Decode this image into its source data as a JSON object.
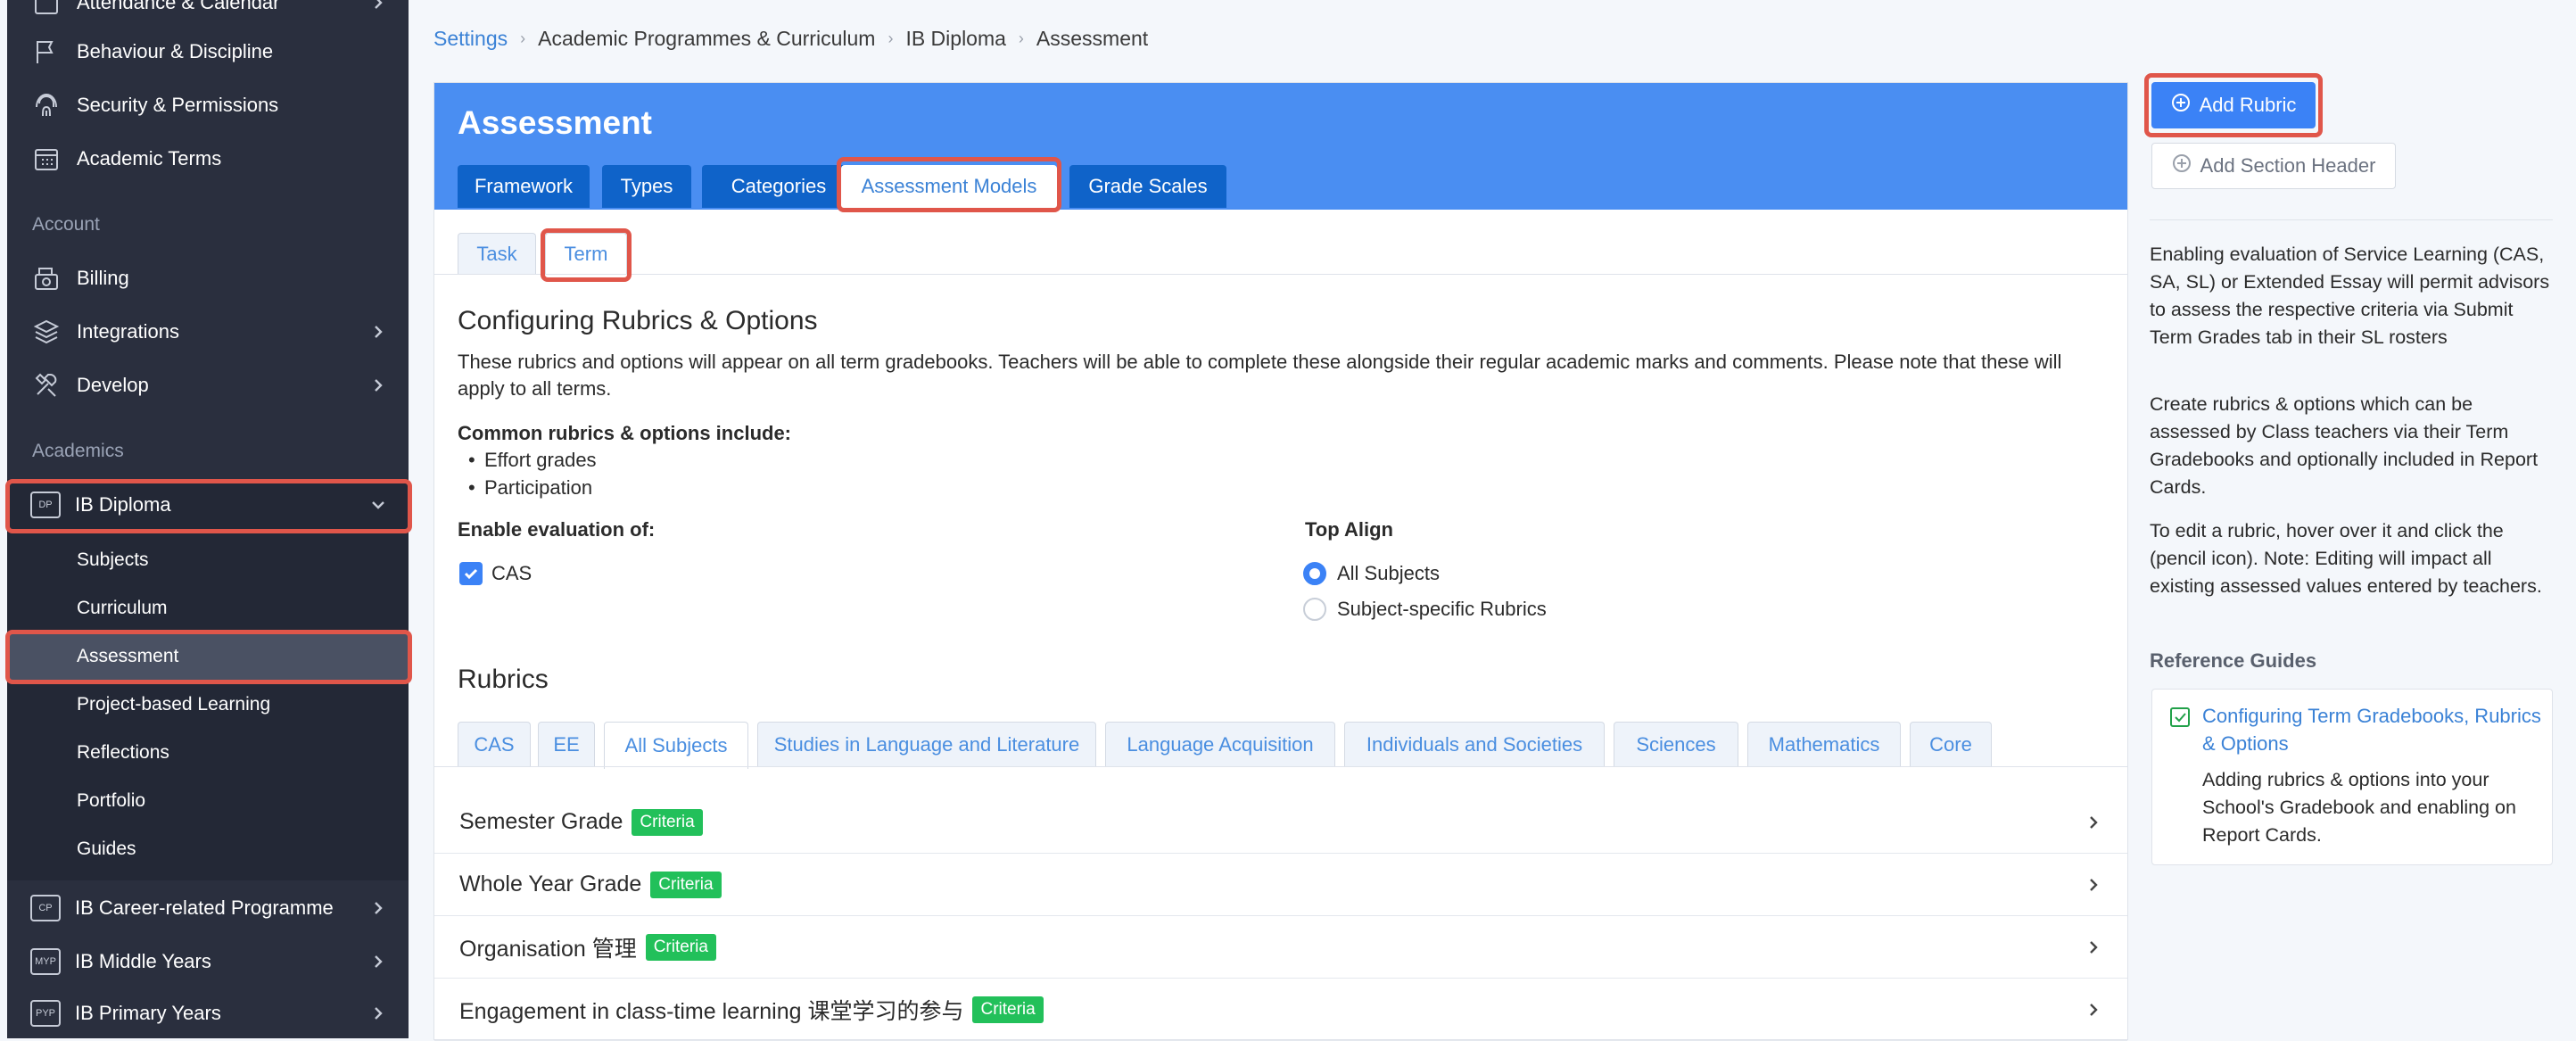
{
  "sidebar": {
    "items_top": [
      {
        "label": "Attendance & Calendar",
        "icon": "calendar-check-icon"
      },
      {
        "label": "Behaviour & Discipline",
        "icon": "flag-icon"
      },
      {
        "label": "Security & Permissions",
        "icon": "fingerprint-icon"
      },
      {
        "label": "Academic Terms",
        "icon": "calendar-grid-icon"
      }
    ],
    "section_account": "Account",
    "account_items": [
      {
        "label": "Billing",
        "icon": "register-icon"
      },
      {
        "label": "Integrations",
        "icon": "layers-icon"
      },
      {
        "label": "Develop",
        "icon": "tools-icon"
      }
    ],
    "section_academics": "Academics",
    "programme": {
      "label": "IB Diploma",
      "badge": "DP"
    },
    "sub_items": [
      "Subjects",
      "Curriculum",
      "Assessment",
      "Project-based Learning",
      "Reflections",
      "Portfolio",
      "Guides"
    ],
    "active_sub": "Assessment",
    "other_programmes": [
      {
        "label": "IB Career-related Programme",
        "badge": "CP"
      },
      {
        "label": "IB Middle Years",
        "badge": "MYP"
      },
      {
        "label": "IB Primary Years",
        "badge": "PYP"
      }
    ]
  },
  "breadcrumb": [
    "Settings",
    "Academic Programmes & Curriculum",
    "IB Diploma",
    "Assessment"
  ],
  "main": {
    "title": "Assessment",
    "tabs": [
      "Framework",
      "Types",
      "Categories",
      "Assessment Models",
      "Grade Scales"
    ],
    "active_tab": "Assessment Models",
    "subtabs": [
      "Task",
      "Term"
    ],
    "active_subtab": "Term",
    "config_title": "Configuring Rubrics & Options",
    "config_desc": "These rubrics and options will appear on all term gradebooks. Teachers will be able to complete these alongside their regular academic marks and comments. Please note that these will apply to all terms.",
    "common_label": "Common rubrics & options include:",
    "common_items": [
      "Effort grades",
      "Participation"
    ],
    "enable_label": "Enable evaluation of:",
    "enable_options": [
      {
        "label": "CAS",
        "checked": true
      }
    ],
    "top_align_label": "Top Align",
    "top_align_options": [
      {
        "label": "All Subjects",
        "selected": true
      },
      {
        "label": "Subject-specific Rubrics",
        "selected": false
      }
    ],
    "rubrics_title": "Rubrics",
    "rubric_tabs": [
      "CAS",
      "EE",
      "All Subjects",
      "Studies in Language and Literature",
      "Language Acquisition",
      "Individuals and Societies",
      "Sciences",
      "Mathematics",
      "Core"
    ],
    "active_rubric_tab": "All Subjects",
    "rubrics": [
      {
        "name": "Semester Grade",
        "tag": "Criteria"
      },
      {
        "name": "Whole Year Grade",
        "tag": "Criteria"
      },
      {
        "name": "Organisation 管理",
        "tag": "Criteria"
      },
      {
        "name": "Engagement in class-time learning 课堂学习的参与",
        "tag": "Criteria"
      }
    ]
  },
  "right_panel": {
    "add_rubric": "Add Rubric",
    "add_section_header": "Add Section Header",
    "info": [
      "Enabling evaluation of Service Learning (CAS, SA, SL) or Extended Essay will permit advisors to assess the respective criteria via Submit Term Grades tab in their SL rosters",
      "Create rubrics & options which can be assessed by Class teachers via their Term Gradebooks and optionally included in Report Cards.",
      "To edit a rubric, hover over it and click the (pencil icon). Note: Editing will impact all existing assessed values entered by teachers."
    ],
    "reference_heading": "Reference Guides",
    "guide": {
      "title": "Configuring Term Gradebooks, Rubrics & Options",
      "description": "Adding rubrics & options into your School's Gradebook and enabling on Report Cards."
    }
  },
  "colors": {
    "sidebar_bg": "#2a2f3e",
    "header_blue": "#4a8ef2",
    "tab_blue": "#0f63c9",
    "primary": "#3b82f6",
    "criteria_green": "#22c05a",
    "highlight_red": "#e0564a"
  }
}
